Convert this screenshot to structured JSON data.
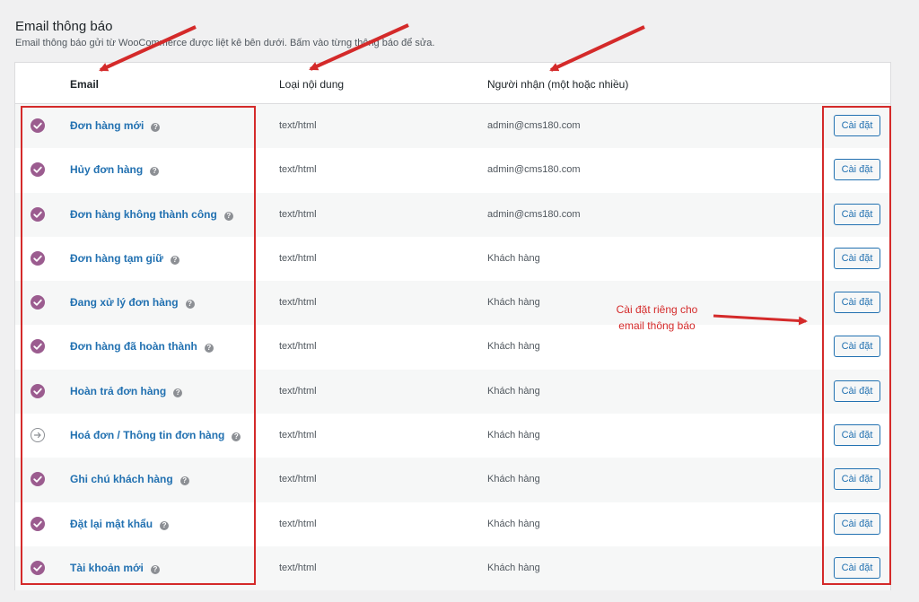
{
  "header": {
    "title": "Email thông báo",
    "description": "Email thông báo gửi từ WooCommerce được liệt kê bên dưới. Bấm vào từng thông báo để sửa."
  },
  "columns": {
    "email": "Email",
    "content_type": "Loại nội dung",
    "recipient": "Người nhận (một hoặc nhiều)"
  },
  "rows": [
    {
      "name": "Đơn hàng mới",
      "status": "enabled",
      "type": "text/html",
      "recipient": "admin@cms180.com",
      "action": "Cài đặt"
    },
    {
      "name": "Hủy đơn hàng",
      "status": "enabled",
      "type": "text/html",
      "recipient": "admin@cms180.com",
      "action": "Cài đặt"
    },
    {
      "name": "Đơn hàng không thành công",
      "status": "enabled",
      "type": "text/html",
      "recipient": "admin@cms180.com",
      "action": "Cài đặt"
    },
    {
      "name": "Đơn hàng tạm giữ",
      "status": "enabled",
      "type": "text/html",
      "recipient": "Khách hàng",
      "action": "Cài đặt"
    },
    {
      "name": "Đang xử lý đơn hàng",
      "status": "enabled",
      "type": "text/html",
      "recipient": "Khách hàng",
      "action": "Cài đặt"
    },
    {
      "name": "Đơn hàng đã hoàn thành",
      "status": "enabled",
      "type": "text/html",
      "recipient": "Khách hàng",
      "action": "Cài đặt"
    },
    {
      "name": "Hoàn trả đơn hàng",
      "status": "enabled",
      "type": "text/html",
      "recipient": "Khách hàng",
      "action": "Cài đặt"
    },
    {
      "name": "Hoá đơn / Thông tin đơn hàng",
      "status": "manual",
      "type": "text/html",
      "recipient": "Khách hàng",
      "action": "Cài đặt"
    },
    {
      "name": "Ghi chú khách hàng",
      "status": "enabled",
      "type": "text/html",
      "recipient": "Khách hàng",
      "action": "Cài đặt"
    },
    {
      "name": "Đặt lại mật khẩu",
      "status": "enabled",
      "type": "text/html",
      "recipient": "Khách hàng",
      "action": "Cài đặt"
    },
    {
      "name": "Tài khoản mới",
      "status": "enabled",
      "type": "text/html",
      "recipient": "Khách hàng",
      "action": "Cài đặt"
    }
  ],
  "annotation": {
    "line1": "Cài đặt riêng cho",
    "line2": "email thông báo"
  },
  "colors": {
    "accent": "#2271b1",
    "enabled_icon": "#9b5c8f",
    "annotation_red": "#d42a2a"
  },
  "icons": {
    "enabled": "checkmark-circle-icon",
    "manual": "arrow-right-circle-icon",
    "help": "question-mark-icon"
  }
}
